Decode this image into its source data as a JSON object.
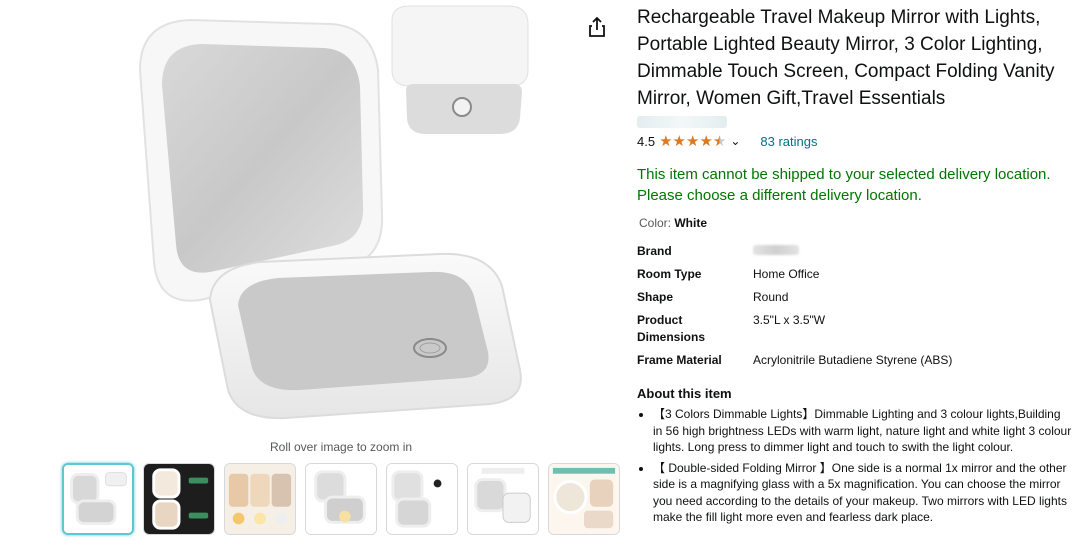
{
  "gallery": {
    "zoom_hint": "Roll over image to zoom in",
    "thumbnails": [
      {
        "name": "thumb-mirror-open",
        "active": true
      },
      {
        "name": "thumb-lit-mirror",
        "active": false
      },
      {
        "name": "thumb-light-modes",
        "active": false
      },
      {
        "name": "thumb-mirror-angle",
        "active": false
      },
      {
        "name": "thumb-mirror-detail",
        "active": false
      },
      {
        "name": "thumb-compact-travel",
        "active": false
      },
      {
        "name": "thumb-lifestyle",
        "active": false
      }
    ],
    "icons": {
      "share": "share-icon"
    }
  },
  "product": {
    "title": "Rechargeable Travel Makeup Mirror with Lights, Portable Lighted Beauty Mirror, 3 Color Lighting, Dimmable Touch Screen, Compact Folding Vanity Mirror, Women Gift,Travel Essentials",
    "rating_value": "4.5",
    "stars": 4.5,
    "ratings_count": "83 ratings",
    "shipping_warning": "This item cannot be shipped to your selected delivery location. Please choose a different delivery location.",
    "color_label": "Color:",
    "color_value": "White",
    "accent_colors": {
      "price_link": "#007185",
      "star": "#de7921",
      "warning": "#007600"
    }
  },
  "specs": [
    {
      "key": "Brand",
      "value": ""
    },
    {
      "key": "Room Type",
      "value": "Home Office"
    },
    {
      "key": "Shape",
      "value": "Round"
    },
    {
      "key": "Product Dimensions",
      "value": "3.5\"L x 3.5\"W"
    },
    {
      "key": "Frame Material",
      "value": "Acrylonitrile Butadiene Styrene (ABS)"
    }
  ],
  "about": {
    "title": "About this item",
    "bullets": [
      "【3 Colors Dimmable Lights】Dimmable Lighting and 3 colour lights,Building in 56 high brightness LEDs with warm light, nature light and white light 3 colour lights. Long press to dimmer light and touch to swith the light colour.",
      "【 Double-sided Folding Mirror 】One side is a normal 1x mirror and the other side is a magnifying glass with a 5x magnification. You can choose the mirror you need according to the details of your makeup. Two mirrors with LED lights make the fill light more even and fearless dark place."
    ]
  }
}
